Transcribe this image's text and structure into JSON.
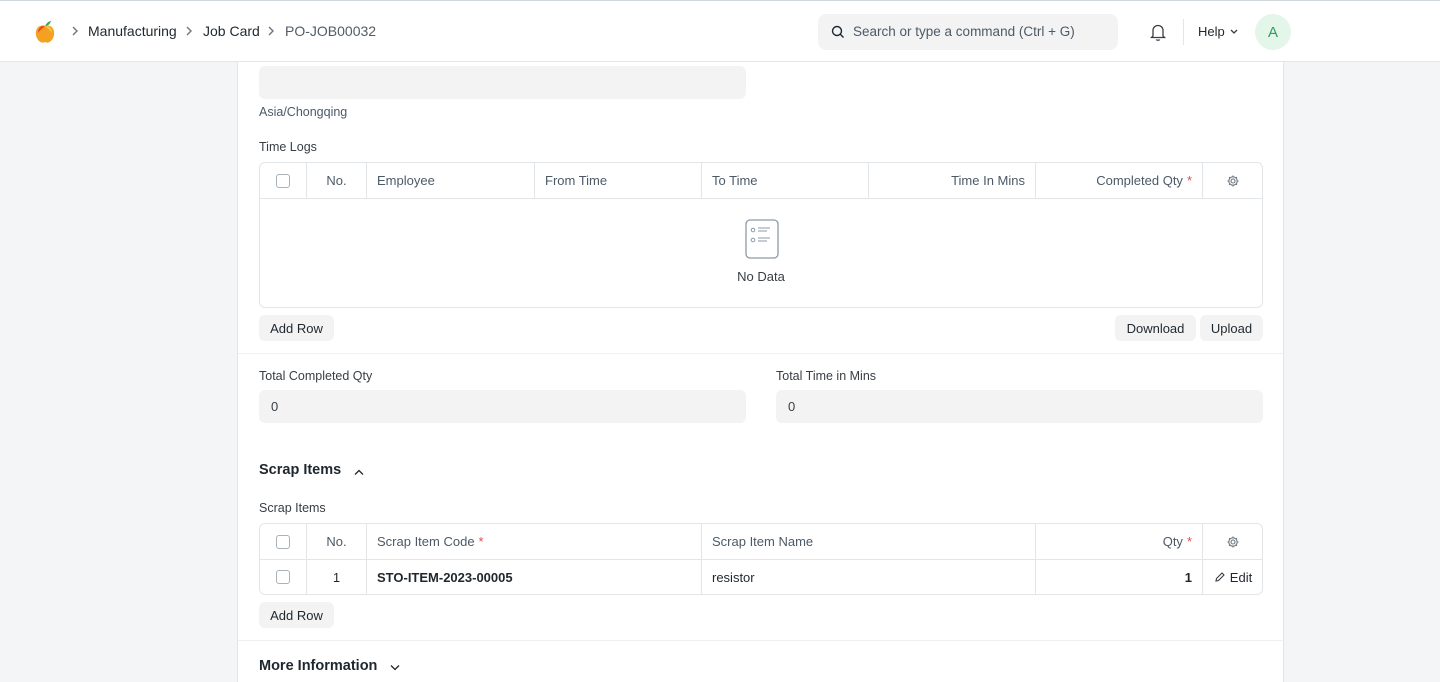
{
  "breadcrumbs": [
    "Manufacturing",
    "Job Card",
    "PO-JOB00032"
  ],
  "search": {
    "placeholder": "Search or type a command (Ctrl + G)"
  },
  "header": {
    "help_label": "Help",
    "avatar_initial": "A"
  },
  "timezone": {
    "text": "Asia/Chongqing"
  },
  "time_logs": {
    "label": "Time Logs",
    "columns": [
      "No.",
      "Employee",
      "From Time",
      "To Time",
      "Time In Mins",
      "Completed Qty"
    ],
    "required_marker": "*",
    "empty_text": "No Data",
    "add_row": "Add Row",
    "download": "Download",
    "upload": "Upload"
  },
  "totals": {
    "completed_qty_label": "Total Completed Qty",
    "completed_qty_value": "0",
    "time_mins_label": "Total Time in Mins",
    "time_mins_value": "0"
  },
  "scrap_section": {
    "title": "Scrap Items",
    "table_label": "Scrap Items",
    "columns": [
      "No.",
      "Scrap Item Code",
      "Scrap Item Name",
      "Qty"
    ],
    "rows": [
      {
        "no": "1",
        "code": "STO-ITEM-2023-00005",
        "name": "resistor",
        "qty": "1",
        "edit": "Edit"
      }
    ],
    "add_row": "Add Row"
  },
  "more_info": {
    "title": "More Information"
  },
  "colors": {
    "accent_green": "#2f9e5d",
    "required_red": "#e24c4c"
  }
}
